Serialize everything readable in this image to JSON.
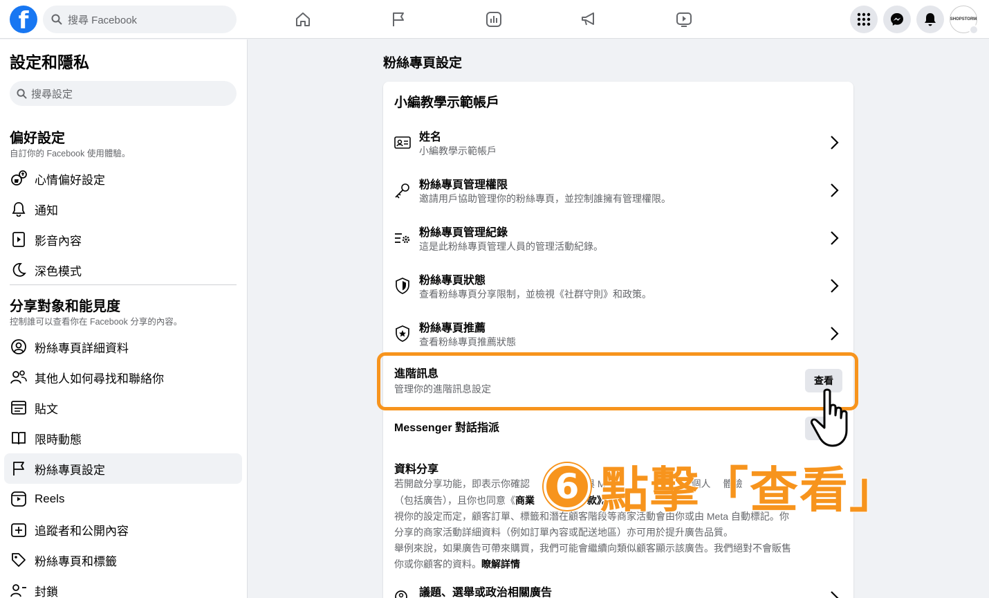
{
  "topbar": {
    "logo": "f",
    "search_placeholder": "搜尋 Facebook",
    "nav_icons": [
      "home-icon",
      "flag-icon",
      "insights-icon",
      "megaphone-icon",
      "video-icon"
    ],
    "right_icons": [
      "menu-grid-icon",
      "messenger-icon",
      "notifications-icon"
    ],
    "avatar_text": "SHOPSTORM"
  },
  "sidebar": {
    "title": "設定和隱私",
    "search_placeholder": "搜尋設定",
    "sections": [
      {
        "heading": "偏好設定",
        "subtitle": "自訂你的 Facebook 使用體驗。",
        "items": [
          {
            "label": "心情偏好設定",
            "icon": "reactions-icon"
          },
          {
            "label": "通知",
            "icon": "bell-icon"
          },
          {
            "label": "影音內容",
            "icon": "media-icon"
          },
          {
            "label": "深色模式",
            "icon": "moon-icon"
          }
        ]
      },
      {
        "heading": "分享對象和能見度",
        "subtitle": "控制誰可以查看你在 Facebook 分享的內容。",
        "items": [
          {
            "label": "粉絲專頁詳細資料",
            "icon": "profile-icon"
          },
          {
            "label": "其他人如何尋找和聯絡你",
            "icon": "people-icon"
          },
          {
            "label": "貼文",
            "icon": "posts-icon"
          },
          {
            "label": "限時動態",
            "icon": "stories-icon"
          },
          {
            "label": "粉絲專頁設定",
            "icon": "flag-icon",
            "active": true
          },
          {
            "label": "Reels",
            "icon": "reels-icon"
          },
          {
            "label": "追蹤者和公開內容",
            "icon": "followers-icon"
          },
          {
            "label": "粉絲專頁和標籤",
            "icon": "tag-icon"
          },
          {
            "label": "封鎖",
            "icon": "block-icon"
          }
        ]
      }
    ]
  },
  "main": {
    "title": "粉絲專頁設定",
    "card_title": "小編教學示範帳戶",
    "rows": [
      {
        "title": "姓名",
        "subtitle": "小編教學示範帳戶",
        "icon": "id-card-icon"
      },
      {
        "title": "粉絲專頁管理權限",
        "subtitle": "邀請用戶協助管理你的粉絲專頁，並控制誰擁有管理權限。",
        "icon": "key-icon"
      },
      {
        "title": "粉絲專頁管理紀錄",
        "subtitle": "這是此粉絲專頁管理人員的管理活動紀錄。",
        "icon": "activity-log-icon"
      },
      {
        "title": "粉絲專頁狀態",
        "subtitle": "查看粉絲專頁分享限制，並檢視《社群守則》和政策。",
        "icon": "shield-icon"
      },
      {
        "title": "粉絲專頁推薦",
        "subtitle": "查看粉絲專頁推薦狀態",
        "icon": "badge-star-icon"
      }
    ],
    "advanced_messaging": {
      "title": "進階訊息",
      "subtitle": "管理你的進階訊息設定",
      "button": "查看"
    },
    "messenger_routing": {
      "title": "Messenger 對話指派"
    },
    "data_sharing": {
      "title": "資料分享",
      "line1": "若開啟分享功能，即表示你確認",
      "line1b": "與 M",
      "line1c": "造個人",
      "line1d": "體驗",
      "line2a": "（包括廣告），且你也同意《",
      "line2b": "商業",
      "line2c": "款》。",
      "p2": "視你的設定而定，顧客訂單、標籤和潛在顧客階段等商家活動會由你或由 Meta 自動標記。你分享的商家活動詳細資料（例如訂單內容或配送地區）亦可用於提升廣告品質。",
      "p3": "舉例來說，如果廣告可帶來購買，我們可能會繼續向類似顧客顯示該廣告。我們絕對不會販售你或你顧客的資料。",
      "learn_more": "瞭解詳情"
    },
    "political_ads": {
      "title": "議題、選舉或政治相關廣告",
      "icon": "political-ads-icon"
    }
  },
  "annotation": {
    "number": "6",
    "text": "點擊「查看」"
  },
  "colors": {
    "brand": "#1877f2",
    "annotation": "#f7941d"
  }
}
